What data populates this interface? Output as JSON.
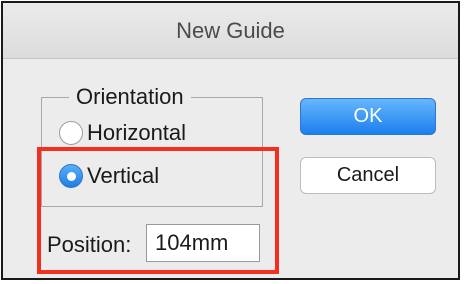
{
  "dialog": {
    "title": "New Guide",
    "orientation": {
      "label": "Orientation",
      "options": [
        {
          "label": "Horizontal",
          "selected": false
        },
        {
          "label": "Vertical",
          "selected": true
        }
      ]
    },
    "position": {
      "label": "Position:",
      "value": "104mm"
    },
    "buttons": {
      "ok": "OK",
      "cancel": "Cancel"
    }
  },
  "colors": {
    "accent": "#1c7ff0",
    "highlight": "#f3301f"
  }
}
